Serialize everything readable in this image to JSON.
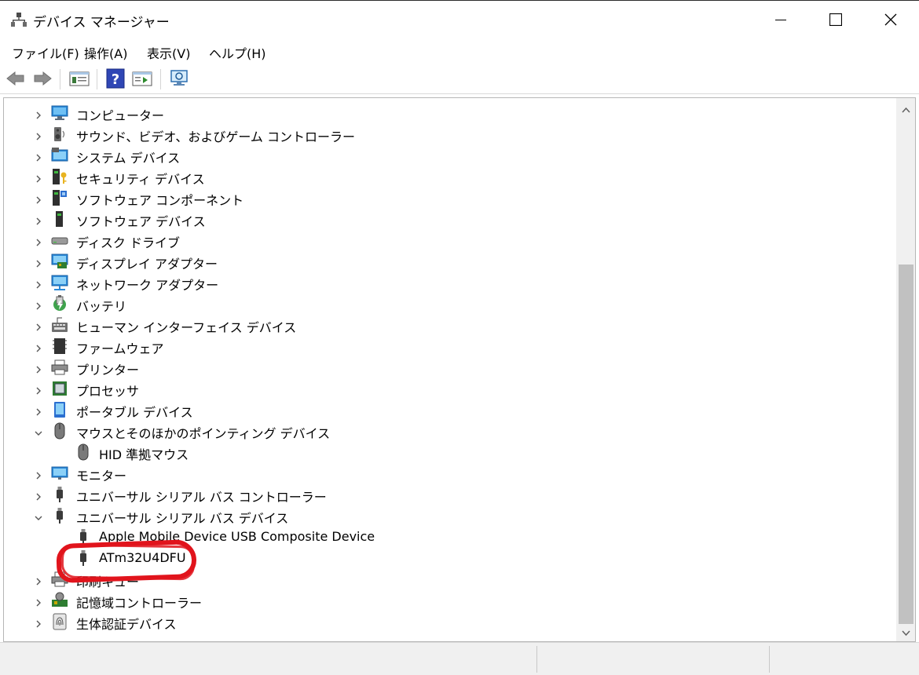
{
  "window": {
    "title": "デバイス マネージャー"
  },
  "menu": {
    "items": [
      "ファイル(F)",
      "操作(A)",
      "表示(V)",
      "ヘルプ(H)"
    ]
  },
  "toolbar": {
    "buttons": [
      "back-icon",
      "forward-icon",
      "properties-icon",
      "help-icon",
      "view-icon",
      "scan-hardware-icon"
    ]
  },
  "tree": {
    "items": [
      {
        "label": "コンピューター",
        "expanded": false,
        "level": 0,
        "icon": "computer-icon"
      },
      {
        "label": "サウンド、ビデオ、およびゲーム コントローラー",
        "expanded": false,
        "level": 0,
        "icon": "speaker-icon"
      },
      {
        "label": "システム デバイス",
        "expanded": false,
        "level": 0,
        "icon": "system-device-icon"
      },
      {
        "label": "セキュリティ デバイス",
        "expanded": false,
        "level": 0,
        "icon": "security-device-icon"
      },
      {
        "label": "ソフトウェア コンポーネント",
        "expanded": false,
        "level": 0,
        "icon": "software-component-icon"
      },
      {
        "label": "ソフトウェア デバイス",
        "expanded": false,
        "level": 0,
        "icon": "software-device-icon"
      },
      {
        "label": "ディスク ドライブ",
        "expanded": false,
        "level": 0,
        "icon": "disk-drive-icon"
      },
      {
        "label": "ディスプレイ アダプター",
        "expanded": false,
        "level": 0,
        "icon": "display-adapter-icon"
      },
      {
        "label": "ネットワーク アダプター",
        "expanded": false,
        "level": 0,
        "icon": "network-adapter-icon"
      },
      {
        "label": "バッテリ",
        "expanded": false,
        "level": 0,
        "icon": "battery-icon"
      },
      {
        "label": "ヒューマン インターフェイス デバイス",
        "expanded": false,
        "level": 0,
        "icon": "hid-icon"
      },
      {
        "label": "ファームウェア",
        "expanded": false,
        "level": 0,
        "icon": "firmware-icon"
      },
      {
        "label": "プリンター",
        "expanded": false,
        "level": 0,
        "icon": "printer-icon"
      },
      {
        "label": "プロセッサ",
        "expanded": false,
        "level": 0,
        "icon": "processor-icon"
      },
      {
        "label": "ポータブル デバイス",
        "expanded": false,
        "level": 0,
        "icon": "portable-device-icon"
      },
      {
        "label": "マウスとそのほかのポインティング デバイス",
        "expanded": true,
        "level": 0,
        "icon": "mouse-icon"
      },
      {
        "label": "HID 準拠マウス",
        "level": 1,
        "icon": "mouse-icon"
      },
      {
        "label": "モニター",
        "expanded": false,
        "level": 0,
        "icon": "monitor-icon"
      },
      {
        "label": "ユニバーサル シリアル バス コントローラー",
        "expanded": false,
        "level": 0,
        "icon": "usb-icon"
      },
      {
        "label": "ユニバーサル シリアル バス デバイス",
        "expanded": true,
        "level": 0,
        "icon": "usb-icon"
      },
      {
        "label": "Apple Mobile Device USB Composite Device",
        "level": 1,
        "icon": "usb-icon"
      },
      {
        "label": "ATm32U4DFU",
        "level": 1,
        "icon": "usb-icon"
      },
      {
        "label": "印刷キュー",
        "expanded": false,
        "level": 0,
        "icon": "print-queue-icon"
      },
      {
        "label": "記憶域コントローラー",
        "expanded": false,
        "level": 0,
        "icon": "storage-controller-icon"
      },
      {
        "label": "生体認証デバイス",
        "expanded": false,
        "level": 0,
        "icon": "biometric-icon"
      }
    ]
  },
  "colors": {
    "annotation": "#e1141c",
    "scroll_thumb": "#c1c1c1"
  }
}
